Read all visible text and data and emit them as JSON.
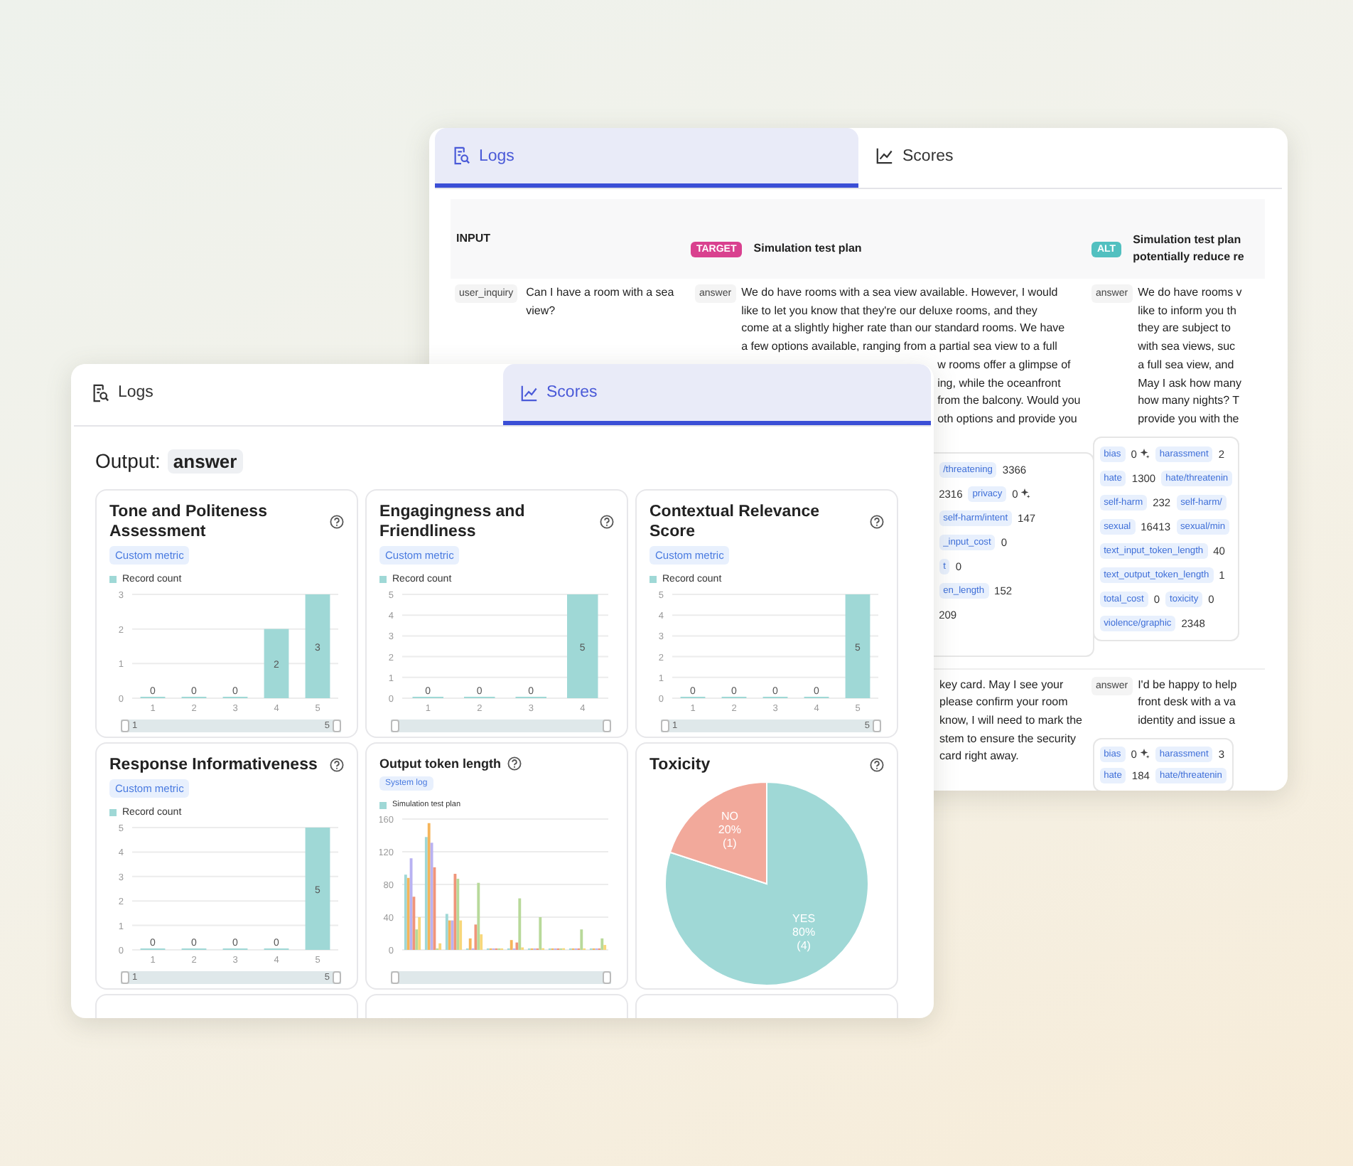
{
  "back_window": {
    "tabs": [
      {
        "label": "Logs",
        "selected": true
      },
      {
        "label": "Scores",
        "selected": false
      }
    ],
    "table": {
      "columns": [
        {
          "label": "INPUT"
        },
        {
          "badge": "TARGET",
          "color": "#d9418f",
          "lines": [
            "Simulation test plan"
          ]
        },
        {
          "badge": "ALT",
          "color": "#52c0c0",
          "lines": [
            "Simulation test plan",
            "potentially reduce re"
          ]
        }
      ],
      "rows": [
        {
          "input": {
            "key": "user_inquiry",
            "text": "Can I have a room with a sea view?"
          },
          "target": {
            "key": "answer",
            "lines": [
              "We do have rooms with a sea view available. However, I would",
              "like to let you know that they're our deluxe rooms, and they",
              "come at a slightly higher rate than our standard rooms. We have",
              "a few options available, ranging from a partial sea view to a full"
            ],
            "covered_lines": [
              "w rooms offer a glimpse of",
              "ing, while the oceanfront",
              "from the balcony. Would you",
              "oth options and provide you"
            ],
            "metrics": [
              [
                {
                  "label": "/threatening",
                  "value": "3366"
                }
              ],
              [
                {
                  "value": "2316"
                },
                {
                  "label": "privacy",
                  "value": "0",
                  "flagged": true
                }
              ],
              [
                {
                  "label": "self-harm/intent",
                  "value": "147"
                }
              ],
              [
                {
                  "label": "_input_cost",
                  "value": "0"
                }
              ],
              [
                {
                  "label": "t",
                  "value": "0"
                }
              ],
              [
                {
                  "label": "en_length",
                  "value": "152"
                }
              ],
              [
                {
                  "value": "209"
                }
              ]
            ]
          },
          "alt": {
            "key": "answer",
            "lines": [
              "We do have rooms v",
              "like to inform you th",
              "they are subject to",
              "with sea views, suc",
              "a full sea view, and",
              "May I ask how many",
              "how many nights? T",
              "provide you with the"
            ],
            "metrics": [
              [
                {
                  "label": "bias",
                  "value": "0",
                  "flagged": true
                },
                {
                  "label": "harassment",
                  "value": "2"
                }
              ],
              [
                {
                  "label": "hate",
                  "value": "1300"
                },
                {
                  "label": "hate/threatenin"
                }
              ],
              [
                {
                  "label": "self-harm",
                  "value": "232"
                },
                {
                  "label": "self-harm/"
                }
              ],
              [
                {
                  "label": "sexual",
                  "value": "16413"
                },
                {
                  "label": "sexual/min"
                }
              ],
              [
                {
                  "label": "text_input_token_length",
                  "value": "40"
                }
              ],
              [
                {
                  "label": "text_output_token_length",
                  "value": "1"
                }
              ],
              [
                {
                  "label": "total_cost",
                  "value": "0"
                },
                {
                  "label": "toxicity",
                  "value": "0"
                }
              ],
              [
                {
                  "label": "violence/graphic",
                  "value": "2348"
                }
              ]
            ]
          }
        },
        {
          "target": {
            "covered_lines": [
              "key card. May I see your",
              "please confirm your room",
              "know, I will need to mark the",
              "stem to ensure the security",
              "card right away."
            ]
          },
          "alt": {
            "key": "answer",
            "lines": [
              "I'd be happy to help",
              "front desk with a va",
              "identity and issue a"
            ],
            "metrics": [
              [
                {
                  "label": "bias",
                  "value": "0",
                  "flagged": true
                },
                {
                  "label": "harassment",
                  "value": "3"
                }
              ],
              [
                {
                  "label": "hate",
                  "value": "184"
                },
                {
                  "label": "hate/threatenin"
                }
              ]
            ]
          }
        }
      ]
    }
  },
  "front_window": {
    "tabs": [
      {
        "label": "Logs",
        "selected": false
      },
      {
        "label": "Scores",
        "selected": true
      }
    ],
    "output": {
      "label": "Output:",
      "value": "answer"
    },
    "cards": [
      {
        "kind": "metric",
        "title": "Tone and Politeness Assessment",
        "tag": "Custom metric",
        "slider": {
          "kind": "range",
          "level": 1,
          "min_label": "1",
          "max_label": "5"
        },
        "chart_data": {
          "type": "bar",
          "categories": [
            "1",
            "2",
            "3",
            "4",
            "5"
          ],
          "series": [
            {
              "name": "Record count",
              "color": "#9fd8d6",
              "values": [
                0,
                0,
                0,
                2,
                3
              ]
            }
          ],
          "ylim": [
            0,
            3
          ],
          "yticks": [
            0,
            1,
            2,
            3
          ],
          "grid": true,
          "data_labels": true
        }
      },
      {
        "kind": "metric",
        "title": "Engagingness and Friendliness",
        "tag": "Custom metric",
        "slider": {
          "kind": "range",
          "level": 1
        },
        "chart_data": {
          "type": "bar",
          "categories": [
            "1",
            "2",
            "3",
            "4"
          ],
          "series": [
            {
              "name": "Record count",
              "color": "#9fd8d6",
              "values": [
                0,
                0,
                0,
                5
              ]
            }
          ],
          "ylim": [
            0,
            5
          ],
          "yticks": [
            0,
            1,
            2,
            3,
            4,
            5
          ],
          "grid": true,
          "data_labels": true
        }
      },
      {
        "kind": "metric",
        "title": "Contextual Relevance Score",
        "tag": "Custom metric",
        "slider": {
          "kind": "range",
          "level": 1,
          "min_label": "1",
          "max_label": "5"
        },
        "chart_data": {
          "type": "bar",
          "categories": [
            "1",
            "2",
            "3",
            "4",
            "5"
          ],
          "series": [
            {
              "name": "Record count",
              "color": "#9fd8d6",
              "values": [
                0,
                0,
                0,
                0,
                5
              ]
            }
          ],
          "ylim": [
            0,
            5
          ],
          "yticks": [
            0,
            1,
            2,
            3,
            4,
            5
          ],
          "grid": true,
          "data_labels": true
        }
      },
      {
        "kind": "metric",
        "title": "Response Informativeness",
        "tag": "Custom metric",
        "slider": {
          "kind": "range",
          "level": 1,
          "min_label": "1",
          "max_label": "5"
        },
        "chart_data": {
          "type": "bar",
          "categories": [
            "1",
            "2",
            "3",
            "4",
            "5"
          ],
          "series": [
            {
              "name": "Record count",
              "color": "#9fd8d6",
              "values": [
                0,
                0,
                0,
                0,
                5
              ]
            }
          ],
          "ylim": [
            0,
            5
          ],
          "yticks": [
            0,
            1,
            2,
            3,
            4,
            5
          ],
          "grid": true,
          "data_labels": true
        }
      },
      {
        "kind": "log",
        "title": "Output token length",
        "tag": "System log",
        "slider": {
          "kind": "range",
          "level": 1
        },
        "chart_data": {
          "type": "bar",
          "ylim": [
            0,
            160
          ],
          "yticks": [
            0,
            40,
            80,
            120,
            160
          ],
          "grid": true,
          "series": [
            {
              "name": "Simulation test plan",
              "color": "#9fd8d6",
              "values": [
                92,
                138,
                44,
                0,
                0,
                0,
                0,
                0,
                0,
                0
              ]
            },
            {
              "color": "#f5b55a",
              "values": [
                88,
                155,
                36,
                14,
                0,
                12,
                0,
                0,
                0,
                1
              ]
            },
            {
              "color": "#b9b2f2",
              "values": [
                112,
                131,
                36,
                0,
                0,
                0,
                0,
                0,
                0,
                0
              ]
            },
            {
              "color": "#f0957a",
              "values": [
                65,
                101,
                93,
                31,
                0,
                9,
                0,
                0,
                0,
                0
              ]
            },
            {
              "color": "#b8d99a",
              "values": [
                25,
                0,
                87,
                82,
                1,
                63,
                40,
                1,
                25,
                14
              ]
            },
            {
              "color": "#f7d77a",
              "values": [
                40,
                8,
                36,
                19,
                0,
                3,
                2,
                2,
                0,
                6
              ]
            }
          ]
        }
      },
      {
        "kind": "metric",
        "title": "Toxicity",
        "chart_data": {
          "type": "pie",
          "categories": [
            "YES",
            "NO"
          ],
          "series": [
            {
              "values": [
                80,
                20
              ]
            }
          ],
          "colors": [
            "#9fd8d6",
            "#f2a99b"
          ],
          "value_labels": [
            [
              "80%",
              "(4)"
            ],
            [
              "20%",
              "(1)"
            ]
          ]
        }
      }
    ]
  }
}
